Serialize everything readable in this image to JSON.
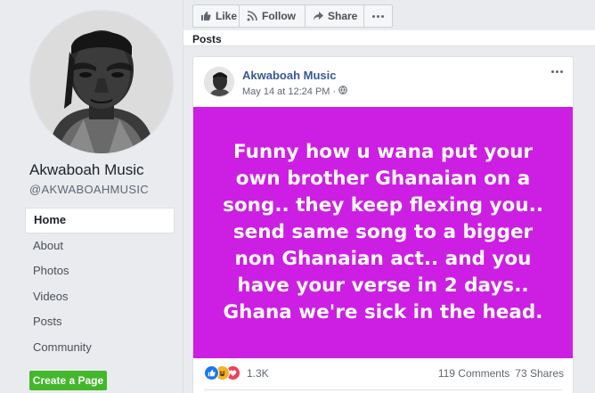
{
  "page": {
    "name": "Akwaboah Music",
    "handle": "@AKWABOAHMUSIC"
  },
  "nav": {
    "items": [
      {
        "label": "Home",
        "active": true
      },
      {
        "label": "About"
      },
      {
        "label": "Photos"
      },
      {
        "label": "Videos"
      },
      {
        "label": "Posts"
      },
      {
        "label": "Community"
      }
    ]
  },
  "create_page_label": "Create a Page",
  "actions": {
    "like": "Like",
    "follow": "Follow",
    "share": "Share"
  },
  "posts_heading": "Posts",
  "post": {
    "author": "Akwaboah Music",
    "date": "May 14 at 12:24 PM",
    "separator": "·",
    "image_text": "Funny how u wana put your\nown brother Ghanaian on a\nsong.. they keep flexing you..\nsend same song to a bigger\nnon Ghanaian act.. and you\nhave your verse in 2 days..\nGhana we're sick in the head.",
    "image_bg": "#cd1ee3",
    "reaction_count": "1.3K",
    "reactions": [
      "like",
      "haha",
      "love"
    ],
    "comments": "119 Comments",
    "shares": "73 Shares"
  },
  "colors": {
    "link_blue": "#385898",
    "create_green": "#42b72a"
  }
}
